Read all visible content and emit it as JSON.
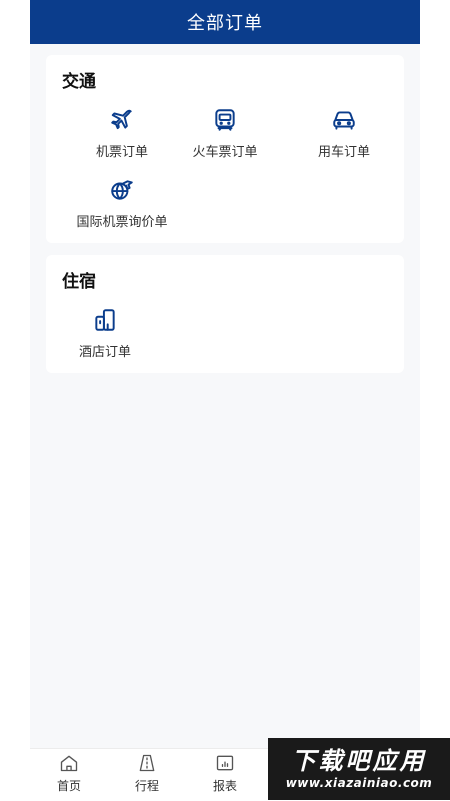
{
  "header": {
    "title": "全部订单"
  },
  "transport": {
    "title": "交通",
    "items": [
      {
        "label": "机票订单",
        "icon": "airplane-icon"
      },
      {
        "label": "火车票订单",
        "icon": "train-icon"
      },
      {
        "label": "用车订单",
        "icon": "car-icon"
      },
      {
        "label": "国际机票询价单",
        "icon": "globe-plane-icon"
      }
    ]
  },
  "lodging": {
    "title": "住宿",
    "items": [
      {
        "label": "酒店订单",
        "icon": "hotel-building-icon"
      }
    ]
  },
  "tabbar": {
    "items": [
      {
        "label": "首页",
        "icon": "home-icon"
      },
      {
        "label": "行程",
        "icon": "road-icon"
      },
      {
        "label": "报表",
        "icon": "report-icon"
      }
    ]
  },
  "watermark": {
    "title": "下载吧应用",
    "url": "www.xiazainiao.com"
  },
  "colors": {
    "header": "#0b3d8c",
    "icon": "#0b3d8c",
    "background": "#f7f8fa"
  }
}
